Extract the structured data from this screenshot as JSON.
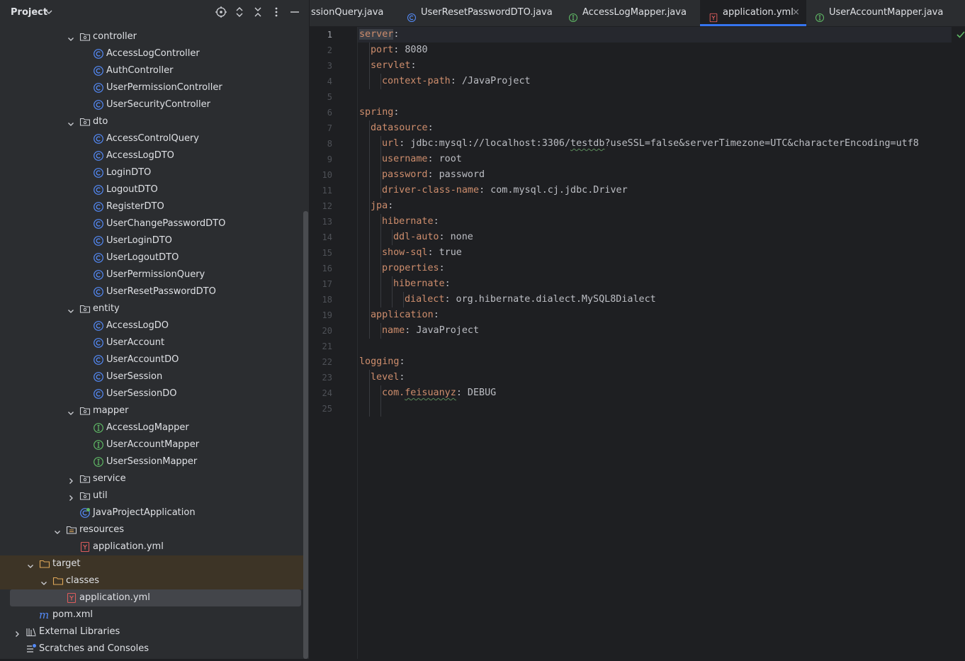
{
  "project_panel": {
    "title": "Project",
    "tree": [
      {
        "label": "controller",
        "kind": "package",
        "expanded": true,
        "depth": 4
      },
      {
        "label": "AccessLogController",
        "kind": "class",
        "depth": 5
      },
      {
        "label": "AuthController",
        "kind": "class",
        "depth": 5
      },
      {
        "label": "UserPermissionController",
        "kind": "class",
        "depth": 5
      },
      {
        "label": "UserSecurityController",
        "kind": "class",
        "depth": 5
      },
      {
        "label": "dto",
        "kind": "package",
        "expanded": true,
        "depth": 4
      },
      {
        "label": "AccessControlQuery",
        "kind": "class",
        "depth": 5
      },
      {
        "label": "AccessLogDTO",
        "kind": "class",
        "depth": 5
      },
      {
        "label": "LoginDTO",
        "kind": "class",
        "depth": 5
      },
      {
        "label": "LogoutDTO",
        "kind": "class",
        "depth": 5
      },
      {
        "label": "RegisterDTO",
        "kind": "class",
        "depth": 5
      },
      {
        "label": "UserChangePasswordDTO",
        "kind": "class",
        "depth": 5
      },
      {
        "label": "UserLoginDTO",
        "kind": "class",
        "depth": 5
      },
      {
        "label": "UserLogoutDTO",
        "kind": "class",
        "depth": 5
      },
      {
        "label": "UserPermissionQuery",
        "kind": "class",
        "depth": 5
      },
      {
        "label": "UserResetPasswordDTO",
        "kind": "class",
        "depth": 5
      },
      {
        "label": "entity",
        "kind": "package",
        "expanded": true,
        "depth": 4
      },
      {
        "label": "AccessLogDO",
        "kind": "class",
        "depth": 5
      },
      {
        "label": "UserAccount",
        "kind": "class",
        "depth": 5
      },
      {
        "label": "UserAccountDO",
        "kind": "class",
        "depth": 5
      },
      {
        "label": "UserSession",
        "kind": "class",
        "depth": 5
      },
      {
        "label": "UserSessionDO",
        "kind": "class",
        "depth": 5
      },
      {
        "label": "mapper",
        "kind": "package",
        "expanded": true,
        "depth": 4
      },
      {
        "label": "AccessLogMapper",
        "kind": "interface",
        "depth": 5
      },
      {
        "label": "UserAccountMapper",
        "kind": "interface",
        "depth": 5
      },
      {
        "label": "UserSessionMapper",
        "kind": "interface",
        "depth": 5
      },
      {
        "label": "service",
        "kind": "package",
        "expanded": false,
        "depth": 4
      },
      {
        "label": "util",
        "kind": "package",
        "expanded": false,
        "depth": 4
      },
      {
        "label": "JavaProjectApplication",
        "kind": "spring-class",
        "depth": 4
      },
      {
        "label": "resources",
        "kind": "resources",
        "expanded": true,
        "depth": 3
      },
      {
        "label": "application.yml",
        "kind": "yaml",
        "depth": 4
      },
      {
        "label": "target",
        "kind": "folder",
        "expanded": true,
        "depth": 1
      },
      {
        "label": "classes",
        "kind": "folder",
        "expanded": true,
        "depth": 2
      },
      {
        "label": "application.yml",
        "kind": "yaml",
        "depth": 3,
        "selected": true
      },
      {
        "label": "pom.xml",
        "kind": "maven",
        "depth": 1
      },
      {
        "label": "External Libraries",
        "kind": "libraries",
        "expanded": false,
        "depth": 0
      },
      {
        "label": "Scratches and Consoles",
        "kind": "scratches",
        "depth": 0
      }
    ]
  },
  "tabs": [
    {
      "label": "ssionQuery.java",
      "kind": "class"
    },
    {
      "label": "UserResetPasswordDTO.java",
      "kind": "class"
    },
    {
      "label": "AccessLogMapper.java",
      "kind": "interface"
    },
    {
      "label": "application.yml",
      "kind": "yaml",
      "active": true,
      "close": "×"
    },
    {
      "label": "UserAccountMapper.java",
      "kind": "interface"
    }
  ],
  "editor": {
    "current_line": 1,
    "lines": [
      {
        "n": "1",
        "indent": 0,
        "key": "server",
        "value": ""
      },
      {
        "n": "2",
        "indent": 1,
        "key": "port",
        "value": "8080"
      },
      {
        "n": "3",
        "indent": 1,
        "key": "servlet",
        "value": ""
      },
      {
        "n": "4",
        "indent": 2,
        "key": "context-path",
        "value": "/JavaProject"
      },
      {
        "n": "5",
        "indent": 0,
        "key": "",
        "value": ""
      },
      {
        "n": "6",
        "indent": 0,
        "key": "spring",
        "value": ""
      },
      {
        "n": "7",
        "indent": 1,
        "key": "datasource",
        "value": ""
      },
      {
        "n": "8",
        "indent": 2,
        "key": "url",
        "value": "jdbc:mysql://localhost:3306/testdb?useSSL=false&serverTimezone=UTC&characterEncoding=utf8"
      },
      {
        "n": "9",
        "indent": 2,
        "key": "username",
        "value": "root"
      },
      {
        "n": "10",
        "indent": 2,
        "key": "password",
        "value": "password"
      },
      {
        "n": "11",
        "indent": 2,
        "key": "driver-class-name",
        "value": "com.mysql.cj.jdbc.Driver"
      },
      {
        "n": "12",
        "indent": 1,
        "key": "jpa",
        "value": ""
      },
      {
        "n": "13",
        "indent": 2,
        "key": "hibernate",
        "value": ""
      },
      {
        "n": "14",
        "indent": 3,
        "key": "ddl-auto",
        "value": "none"
      },
      {
        "n": "15",
        "indent": 2,
        "key": "show-sql",
        "value": "true"
      },
      {
        "n": "16",
        "indent": 2,
        "key": "properties",
        "value": ""
      },
      {
        "n": "17",
        "indent": 3,
        "key": "hibernate",
        "value": ""
      },
      {
        "n": "18",
        "indent": 4,
        "key": "dialect",
        "value": "org.hibernate.dialect.MySQL8Dialect"
      },
      {
        "n": "19",
        "indent": 1,
        "key": "application",
        "value": ""
      },
      {
        "n": "20",
        "indent": 2,
        "key": "name",
        "value": "JavaProject"
      },
      {
        "n": "21",
        "indent": 0,
        "key": "",
        "value": ""
      },
      {
        "n": "22",
        "indent": 0,
        "key": "logging",
        "value": ""
      },
      {
        "n": "23",
        "indent": 1,
        "key": "level",
        "value": ""
      },
      {
        "n": "24",
        "indent": 2,
        "key": "com.feisuanyz",
        "value": "DEBUG"
      },
      {
        "n": "25",
        "indent": 0,
        "key": "",
        "value": ""
      }
    ]
  },
  "colors": {
    "key": "#cf8e6d",
    "class_icon": "#548af7",
    "interface_icon": "#5fb865",
    "yaml_icon": "#db5c5c",
    "accent": "#3574f0"
  }
}
